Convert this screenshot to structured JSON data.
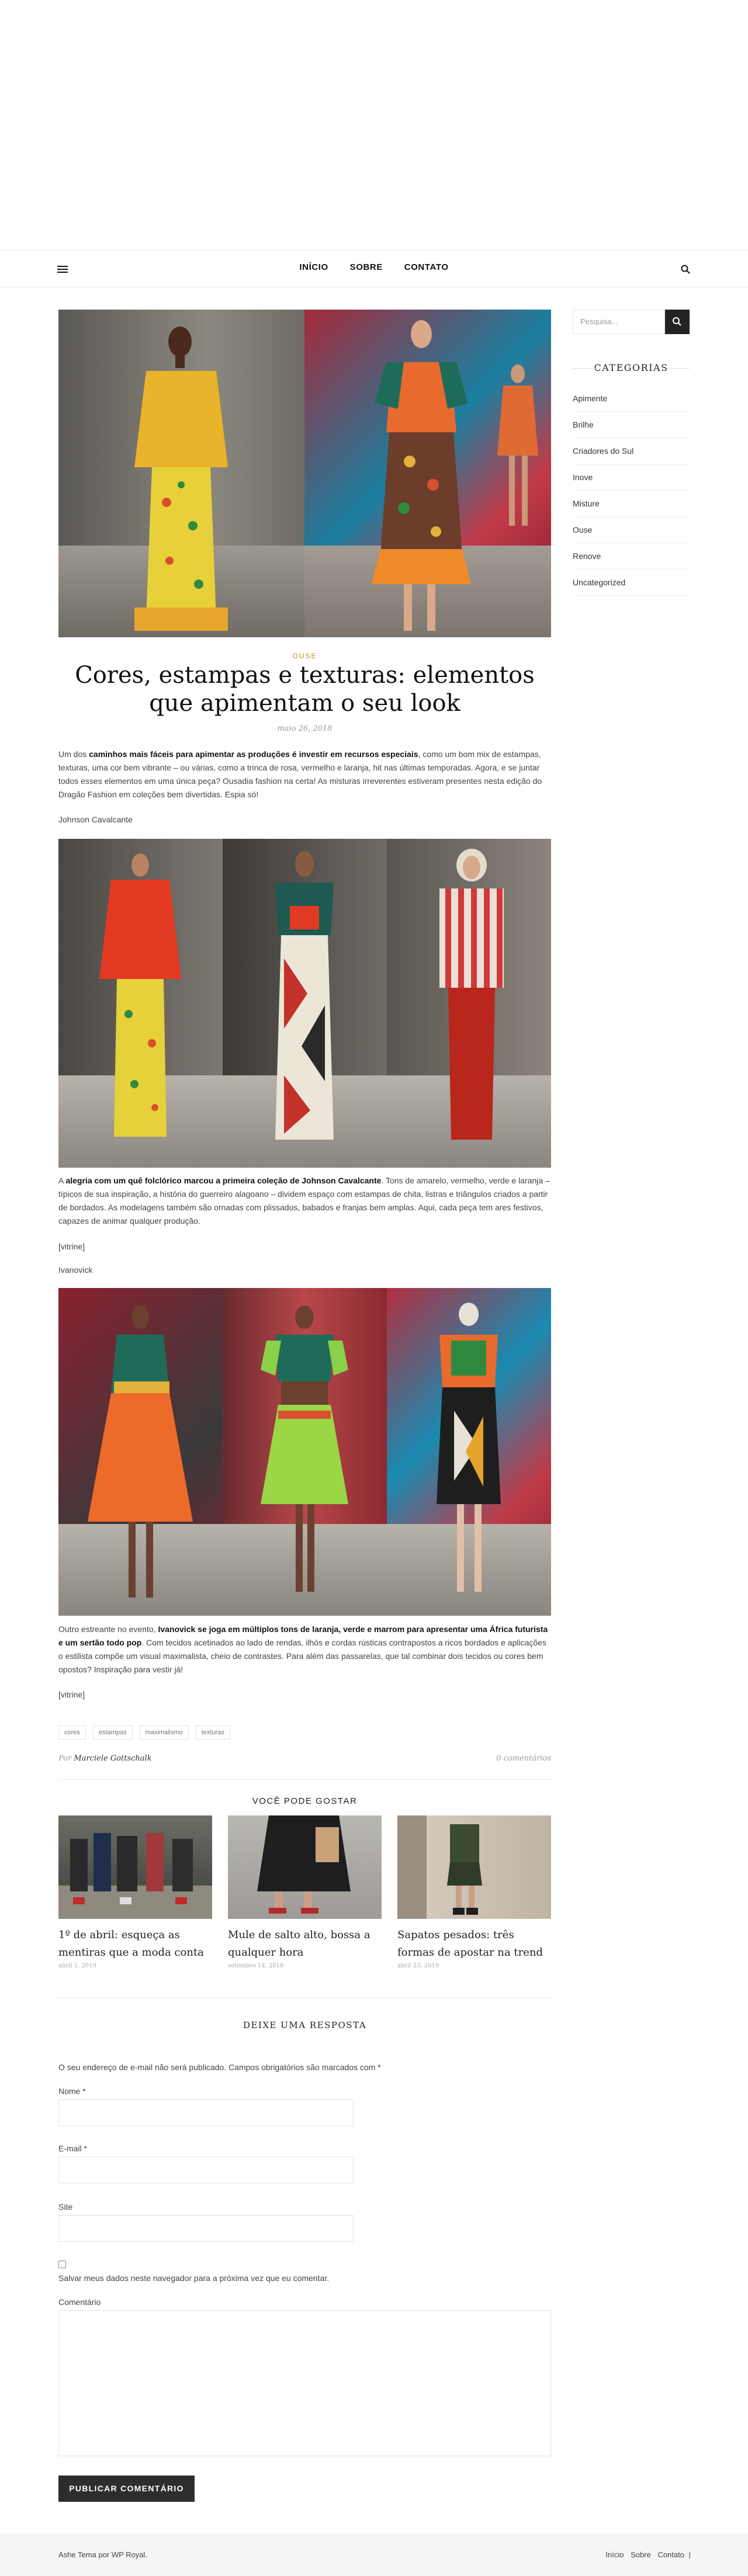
{
  "nav": {
    "items": [
      "INÍCIO",
      "SOBRE",
      "CONTATO"
    ]
  },
  "sidebar": {
    "search_placeholder": "Pesquisa...",
    "widget_title": "CATEGORIAS",
    "categories": [
      "Apimente",
      "Brilhe",
      "Criadores do Sul",
      "Inove",
      "Misture",
      "Ouse",
      "Renove",
      "Uncategorized"
    ]
  },
  "post": {
    "category": "OUSE",
    "title": "Cores, estampas e texturas: elementos que apimentam o seu look",
    "date": "maio 26, 2018",
    "intro_pre": "Um dos ",
    "intro_bold": "caminhos mais fáceis para apimentar as produções é investir em recursos especiais",
    "intro_post": ", como um bom mix de estampas, texturas, uma cor bem vibrante – ou várias, como a trinca de rosa, vermelho e laranja, hit nas últimas temporadas. Agora, e se juntar todos esses elementos em uma única peça? Ousadia fashion na certa! As misturas irreverentes estiveram presentes nesta edição do Dragão Fashion em coleções bem divertidas.  Espia só!",
    "caption1": "Johnson Cavalcante",
    "p2_pre": "A ",
    "p2_bold": "alegria com um quê folclórico marcou a primeira coleção de Johnson Cavalcante",
    "p2_post": ". Tons de amarelo, vermelho, verde e laranja – típicos de sua inspiração, a história do guerreiro alagoano – dividem espaço com estampas de chita, listras e triângulos criados a partir de bordados. As modelagens também são ornadas com plissados, babados e franjas bem amplas. Aqui, cada peça tem ares festivos, capazes de animar qualquer produção.",
    "vitrine1": "[vitrine]",
    "caption2": "Ivanovick",
    "p3_pre": "Outro estreante no evento, ",
    "p3_bold": "Ivanovick se joga em múltiplos tons de laranja, verde e marrom para apresentar uma África futurista e um sertão todo pop",
    "p3_post": ". Com tecidos acetinados ao lado de rendas, ilhós e cordas rústicas contrapostos a ricos bordados e aplicações o estilista compõe um visual maximalista, cheio de contrastes. Para além das passarelas, que tal combinar dois tecidos ou cores bem opostos? Inspiração para vestir já!",
    "vitrine2": "[vitrine]",
    "tags": [
      "cores",
      "estampas",
      "maximalismo",
      "texturas"
    ],
    "author_prefix": "Por",
    "author": "Marciele Gottschalk",
    "comments": "0 comentários"
  },
  "related": {
    "title": "VOCÊ PODE GOSTAR",
    "items": [
      {
        "title": "1º de abril: esqueça as mentiras que a moda conta",
        "date": "abril 1, 2019"
      },
      {
        "title": "Mule de salto alto, bossa a qualquer hora",
        "date": "setembro 14, 2018"
      },
      {
        "title": "Sapatos pesados: três formas de apostar na trend",
        "date": "abril 23, 2019"
      }
    ]
  },
  "comment_form": {
    "title": "DEIXE UMA RESPOSTA",
    "note": "O seu endereço de e-mail não será publicado. Campos obrigatórios são marcados com *",
    "name_label": "Nome *",
    "email_label": "E-mail *",
    "site_label": "Site",
    "save_label": "Salvar meus dados neste navegador para a próxima vez que eu comentar.",
    "comment_label": "Comentário",
    "submit": "PUBLICAR COMENTÁRIO"
  },
  "footer": {
    "copyright": "Ashe Tema por WP Royal.",
    "links": [
      "Início",
      "Sobre",
      "Contato"
    ]
  },
  "colors": {
    "accent": "#c58a2d",
    "button_dark": "#2d2d2d"
  }
}
